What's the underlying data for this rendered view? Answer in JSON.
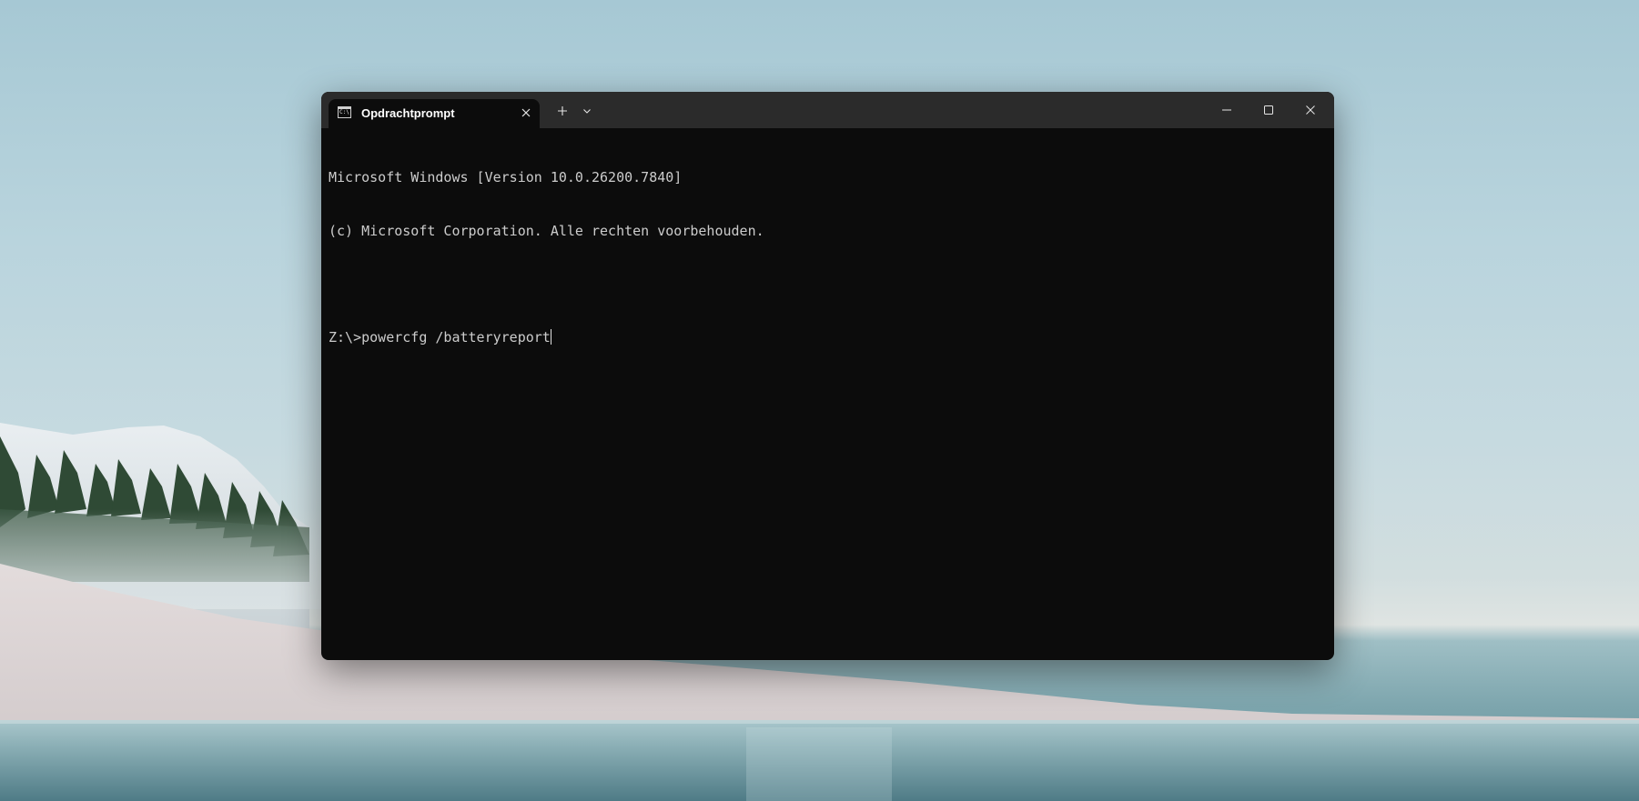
{
  "window": {
    "tab_title": "Opdrachtprompt",
    "tab_icon": "cmd-icon",
    "tab_icon_text": "C:\\",
    "new_tab_icon": "plus-icon",
    "dropdown_icon": "chevron-down-icon",
    "controls": {
      "minimize": "minimize-icon",
      "maximize": "maximize-icon",
      "close": "close-icon"
    }
  },
  "terminal": {
    "lines": [
      "Microsoft Windows [Version 10.0.26200.7840]",
      "(c) Microsoft Corporation. Alle rechten voorbehouden.",
      "",
      "Z:\\>powercfg /batteryreport"
    ]
  },
  "colors": {
    "titlebar": "#2b2b2b",
    "terminal_bg": "#0c0c0c",
    "terminal_text": "#cccccc"
  }
}
